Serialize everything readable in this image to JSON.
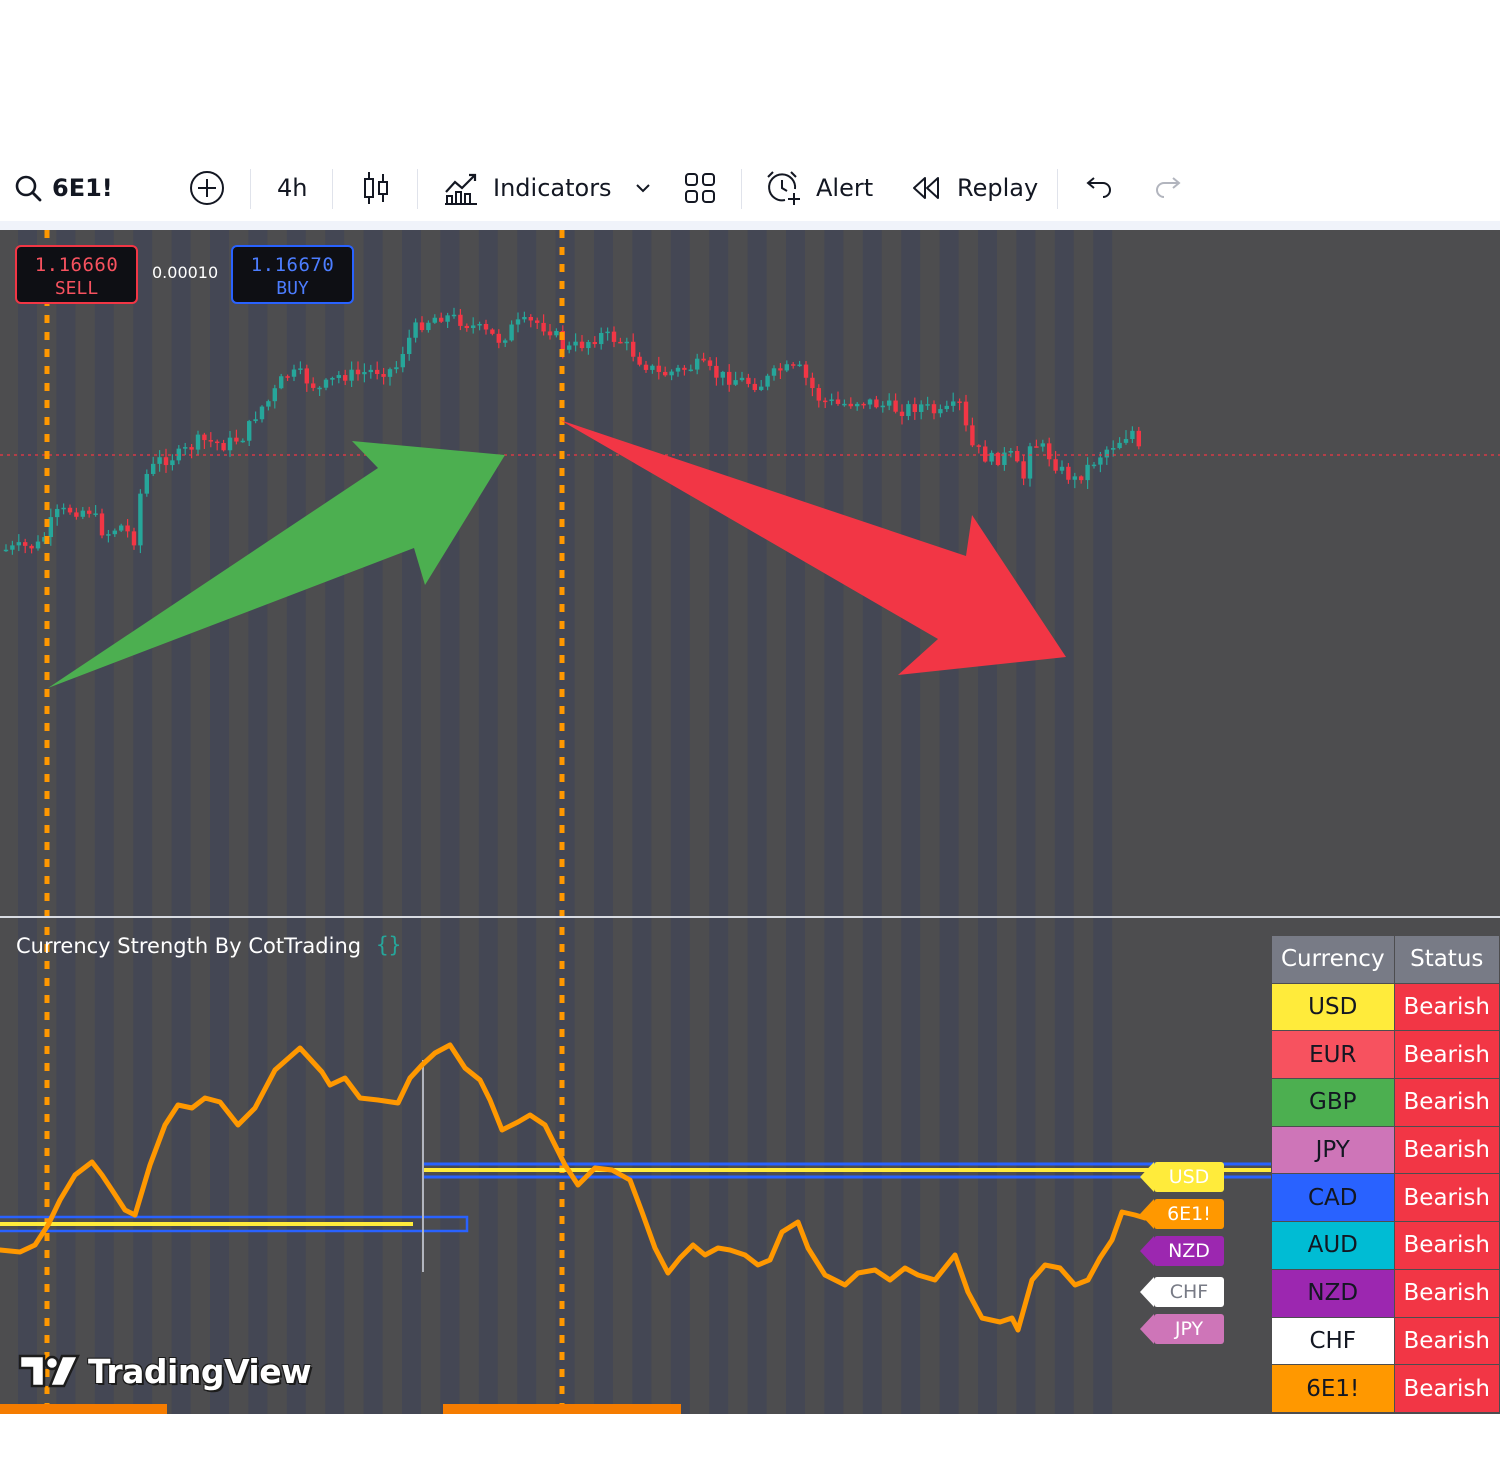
{
  "toolbar": {
    "symbol": "6E1!",
    "interval": "4h",
    "indicators_label": "Indicators",
    "alert_label": "Alert",
    "replay_label": "Replay"
  },
  "order_panel": {
    "sell_price": "1.16660",
    "sell_label": "SELL",
    "spread": "0.00010",
    "buy_price": "1.16670",
    "buy_label": "BUY"
  },
  "indicator": {
    "title": "Currency Strength By CotTrading",
    "settings_glyph": "{}"
  },
  "line_labels": [
    {
      "text": "USD",
      "bg": "#ffeb3b",
      "fg": "#ffffff"
    },
    {
      "text": "6E1!",
      "bg": "#ff9800",
      "fg": "#ffffff"
    },
    {
      "text": "NZD",
      "bg": "#9c27b0",
      "fg": "#ffffff"
    },
    {
      "text": "CHF",
      "bg": "#ffffff",
      "fg": "#787b86"
    },
    {
      "text": "JPY",
      "bg": "#ce75b8",
      "fg": "#ffffff"
    }
  ],
  "status_table": {
    "headers": [
      "Currency",
      "Status"
    ],
    "rows": [
      {
        "currency": "USD",
        "status": "Bearish",
        "bg": "#ffeb3b",
        "fg": "#131722"
      },
      {
        "currency": "EUR",
        "status": "Bearish",
        "bg": "#f7525f",
        "fg": "#131722"
      },
      {
        "currency": "GBP",
        "status": "Bearish",
        "bg": "#4caf50",
        "fg": "#131722"
      },
      {
        "currency": "JPY",
        "status": "Bearish",
        "bg": "#ce75b8",
        "fg": "#131722"
      },
      {
        "currency": "CAD",
        "status": "Bearish",
        "bg": "#2962ff",
        "fg": "#131722"
      },
      {
        "currency": "AUD",
        "status": "Bearish",
        "bg": "#00bcd4",
        "fg": "#131722"
      },
      {
        "currency": "NZD",
        "status": "Bearish",
        "bg": "#9c27b0",
        "fg": "#131722"
      },
      {
        "currency": "CHF",
        "status": "Bearish",
        "bg": "#ffffff",
        "fg": "#131722"
      },
      {
        "currency": "6E1!",
        "status": "Bearish",
        "bg": "#ff9800",
        "fg": "#131722"
      }
    ]
  },
  "logo_text": "TradingView",
  "colors": {
    "bull": "#26a69a",
    "bear": "#f23645",
    "strength_line": "#ff9800",
    "session_marker": "#ff9800",
    "up_arrow": "#4caf50",
    "down_arrow": "#f23645"
  }
}
